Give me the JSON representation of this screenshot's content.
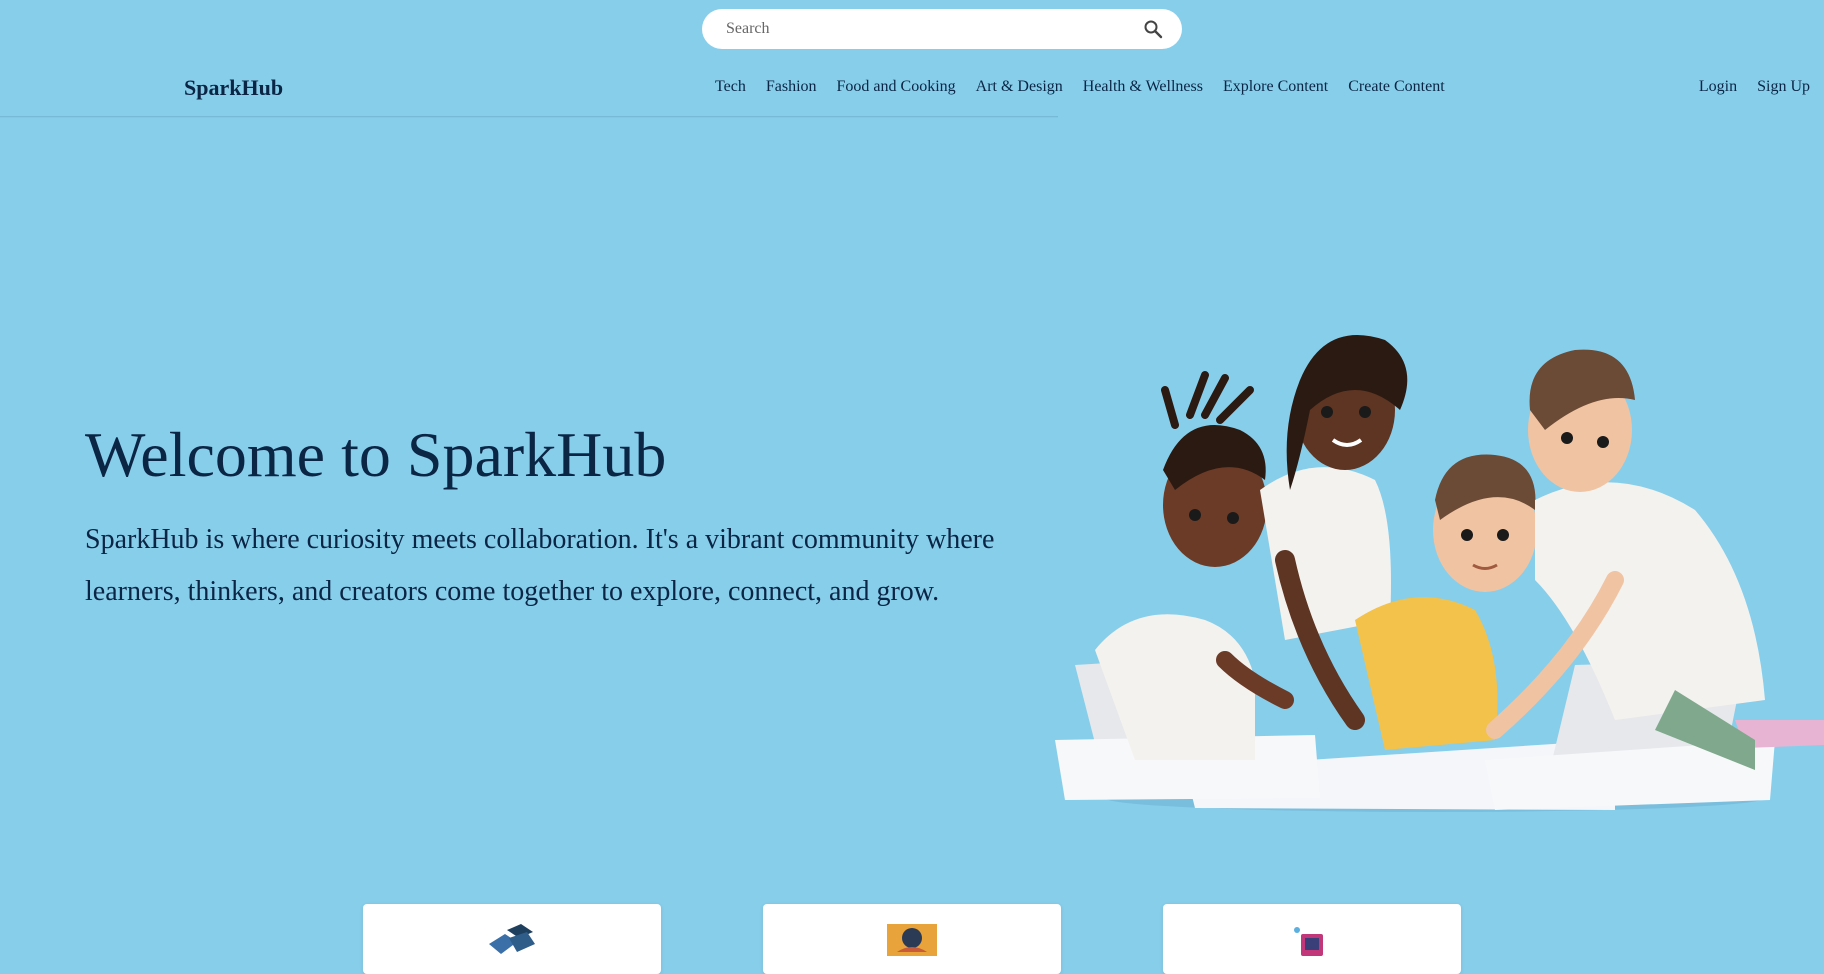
{
  "search": {
    "placeholder": "Search"
  },
  "navbar": {
    "brand": "SparkHub",
    "links": [
      {
        "label": "Tech"
      },
      {
        "label": "Fashion"
      },
      {
        "label": "Food and Cooking"
      },
      {
        "label": "Art & Design"
      },
      {
        "label": "Health & Wellness"
      },
      {
        "label": "Explore Content"
      },
      {
        "label": "Create Content"
      }
    ],
    "auth": {
      "login": "Login",
      "signup": "Sign Up"
    }
  },
  "hero": {
    "title": "Welcome to SparkHub",
    "text": "SparkHub is where curiosity meets collaboration. It's a vibrant community where learners, thinkers, and creators come together to explore, connect, and grow.",
    "illustration": "people-collaborating-illustration"
  },
  "cards": [
    {
      "icon": "tech-icon"
    },
    {
      "icon": "art-icon"
    },
    {
      "icon": "device-icon"
    }
  ],
  "colors": {
    "background": "#87ceeb",
    "text": "#0b2545",
    "card": "#ffffff"
  }
}
